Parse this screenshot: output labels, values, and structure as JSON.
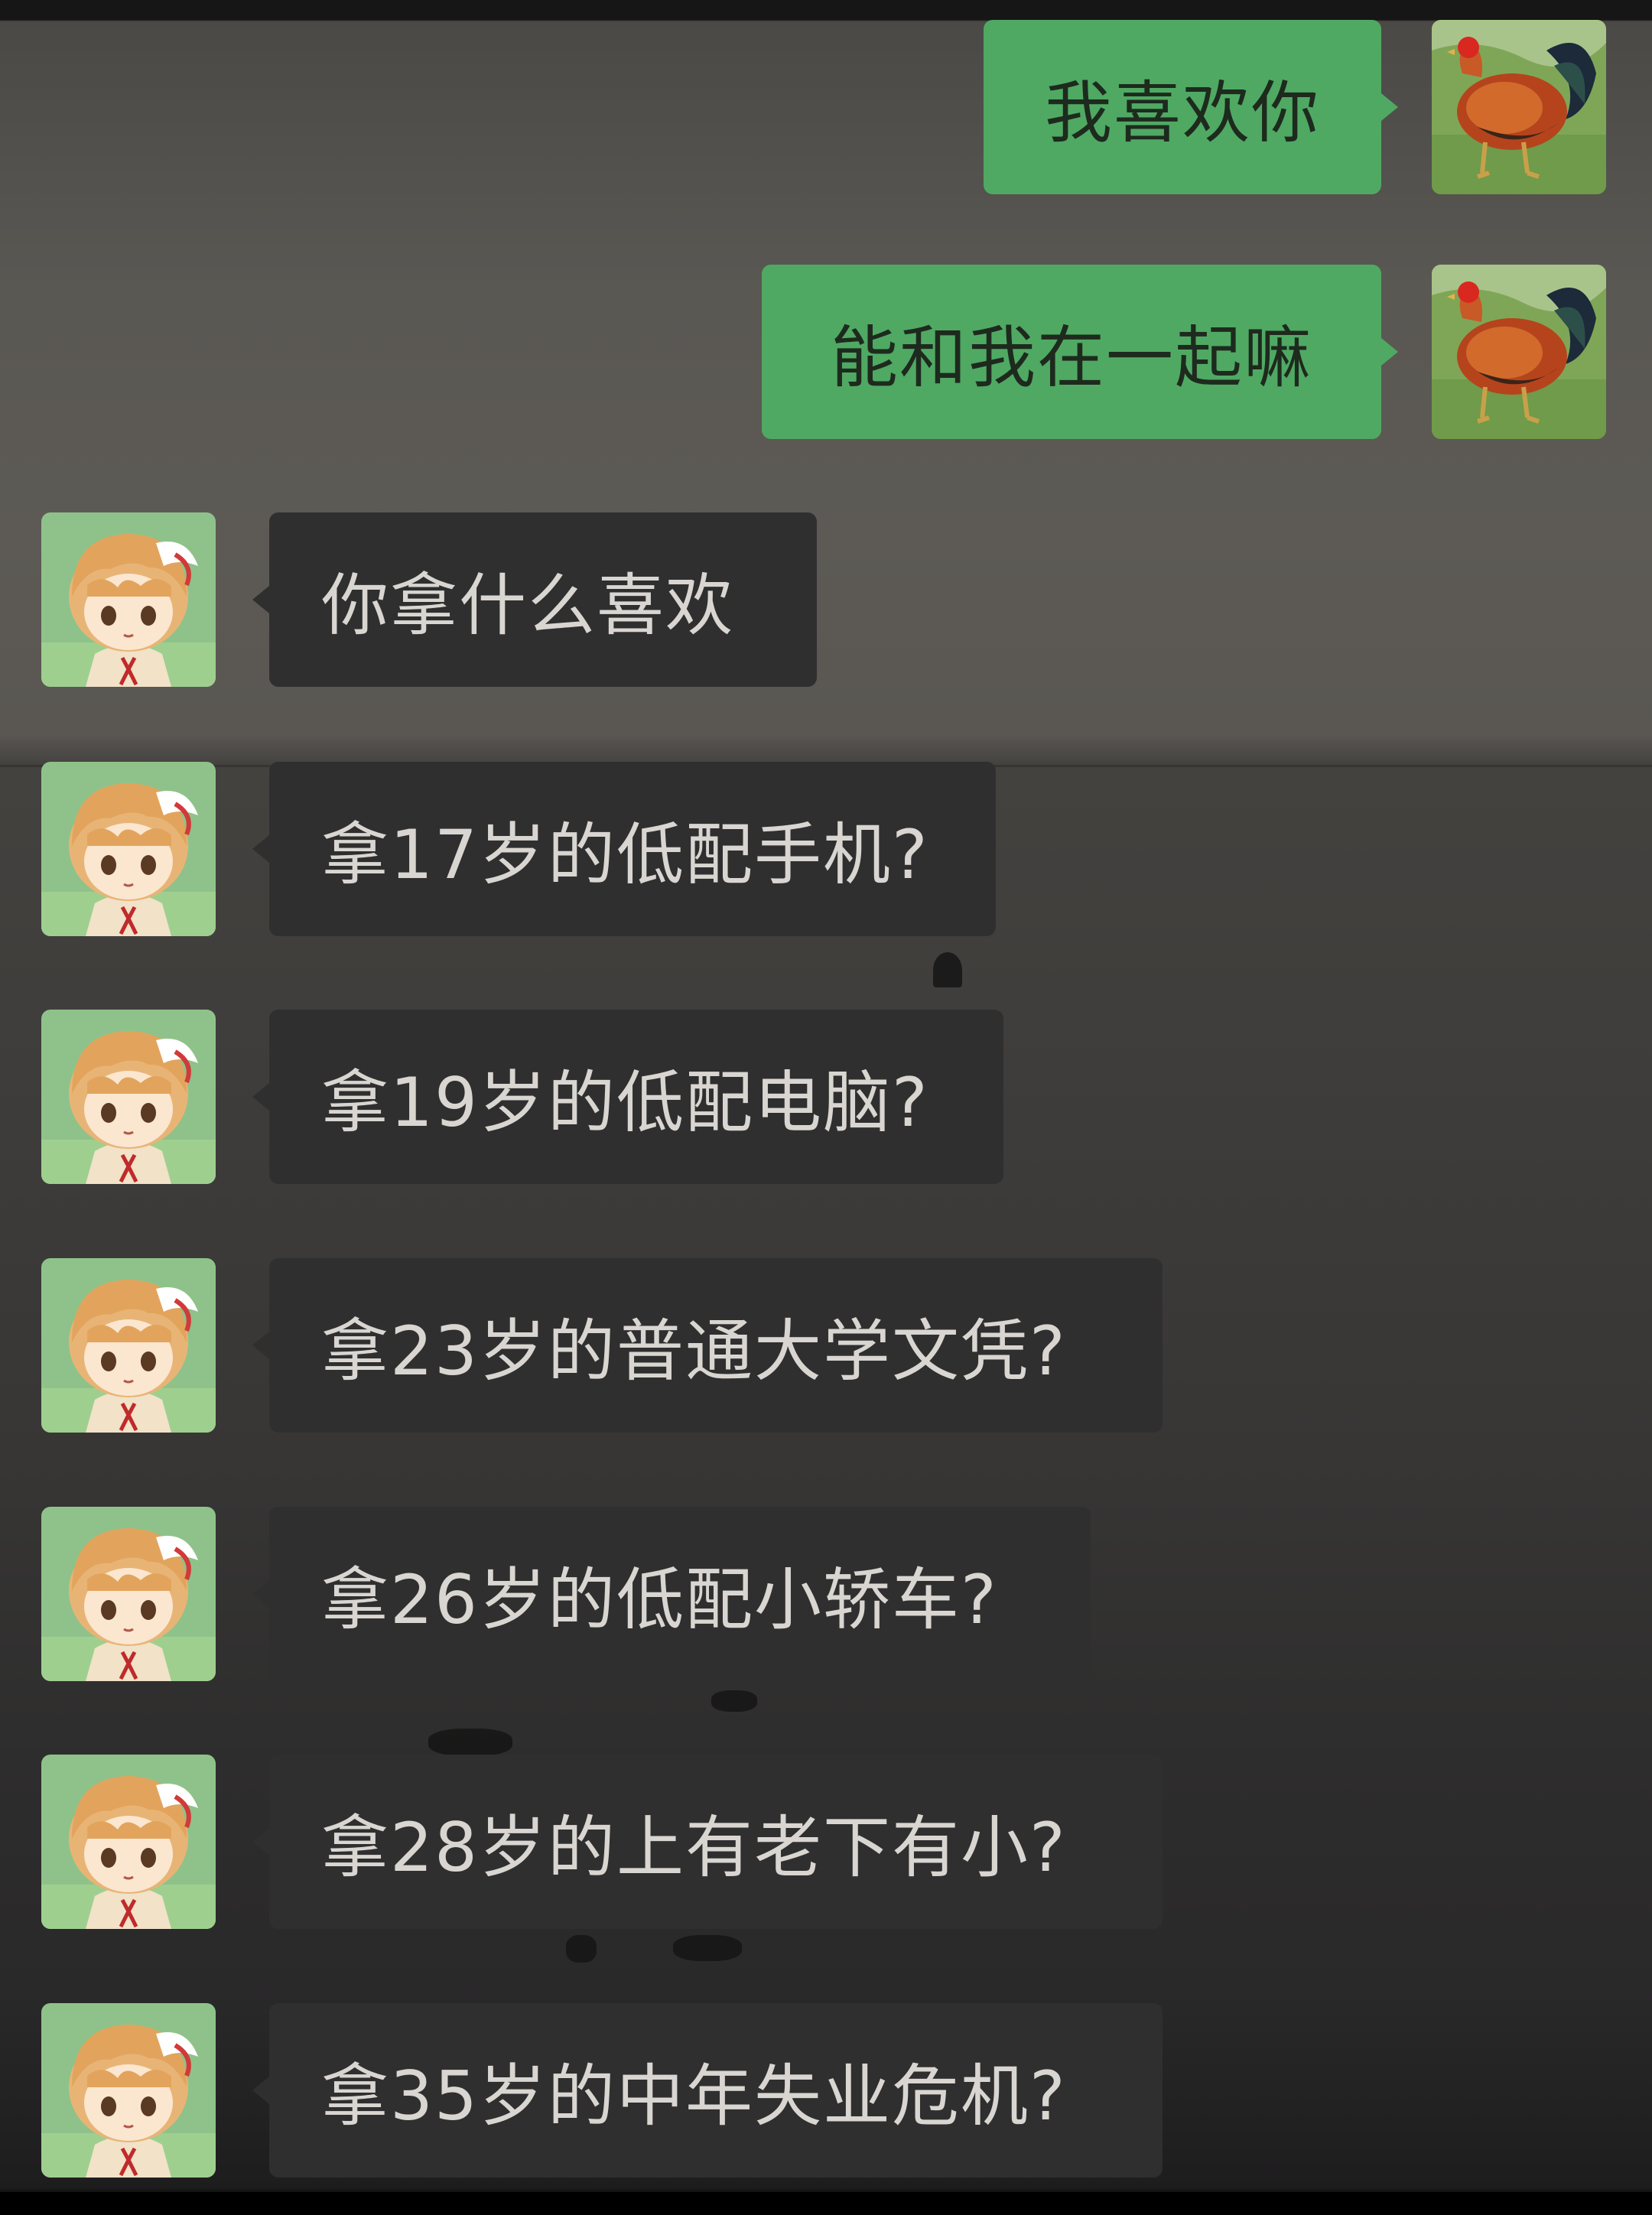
{
  "chat": {
    "sent_messages": [
      {
        "sender": "rooster-avatar",
        "text": "我喜欢你"
      },
      {
        "sender": "rooster-avatar",
        "text": "能和我在一起嘛"
      }
    ],
    "received_messages": [
      {
        "sender": "anime-girl-avatar",
        "text": "你拿什么喜欢"
      },
      {
        "sender": "anime-girl-avatar",
        "text": "拿17岁的低配手机?"
      },
      {
        "sender": "anime-girl-avatar",
        "text": "拿19岁的低配电脑?"
      },
      {
        "sender": "anime-girl-avatar",
        "text": "拿23岁的普通大学文凭?"
      },
      {
        "sender": "anime-girl-avatar",
        "text": "拿26岁的低配小轿车?"
      },
      {
        "sender": "anime-girl-avatar",
        "text": "拿28岁的上有老下有小?"
      },
      {
        "sender": "anime-girl-avatar",
        "text": "拿35岁的中年失业危机?"
      }
    ]
  },
  "colors": {
    "sent_bubble": "#4fa963",
    "received_bubble": "#302f30",
    "received_text": "#d9d6d2",
    "sent_text": "#1e2a1e"
  }
}
